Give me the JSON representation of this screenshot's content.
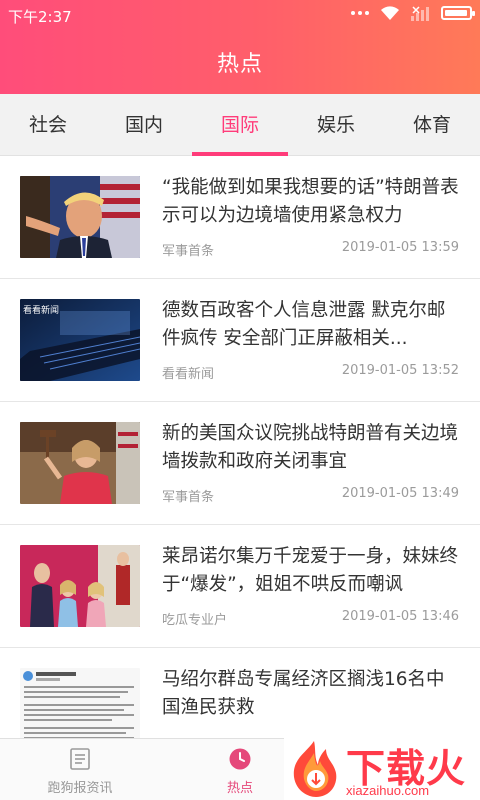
{
  "status_bar": {
    "time": "下午2:37",
    "battery_level": 0.95,
    "icons": [
      "dots-icon",
      "wifi-icon",
      "signal-icon",
      "battery-icon"
    ]
  },
  "header": {
    "title": "热点",
    "gradient": [
      "#ff4d7a",
      "#ff7a58"
    ]
  },
  "tabs": [
    {
      "label": "社会"
    },
    {
      "label": "国内"
    },
    {
      "label": "国际",
      "active": true
    },
    {
      "label": "娱乐"
    },
    {
      "label": "体育"
    }
  ],
  "accent_color": "#ff3c7a",
  "news": [
    {
      "title": "“我能做到如果我想要的话”特朗普表示可以为边境墙使用紧急权力",
      "source": "军事首条",
      "date": "2019-01-05 13:59",
      "thumb_icon": "photo-trump-pointing"
    },
    {
      "title": "德数百政客个人信息泄露 默克尔邮件疯传 安全部门正屏蔽相关...",
      "source": "看看新闻",
      "date": "2019-01-05 13:52",
      "thumb_caption": "看看新闻",
      "thumb_icon": "photo-laptop-keyboard"
    },
    {
      "title": "新的美国众议院挑战特朗普有关边境墙拨款和政府关闭事宜",
      "source": "军事首条",
      "date": "2019-01-05 13:49",
      "thumb_icon": "photo-speaker-gavel"
    },
    {
      "title": "莱昂诺尔集万千宠爱于一身，妹妹终于“爆发”，姐姐不哄反而嘲讽",
      "source": "吃瓜专业户",
      "date": "2019-01-05 13:46",
      "thumb_icon": "photo-royal-family"
    },
    {
      "title": "马绍尔群岛专属经济区搁浅16名中国渔民获救",
      "source": "",
      "date": "",
      "thumb_icon": "photo-social-post"
    }
  ],
  "bottom_nav": [
    {
      "label": "跑狗报资讯",
      "icon": "list-icon"
    },
    {
      "label": "热点",
      "icon": "clock-icon",
      "active": true
    },
    {
      "label": "",
      "icon": ""
    }
  ],
  "watermark": {
    "brand": "下载火",
    "url": "xiazaihuo.com",
    "icon": "flame-download-icon"
  }
}
